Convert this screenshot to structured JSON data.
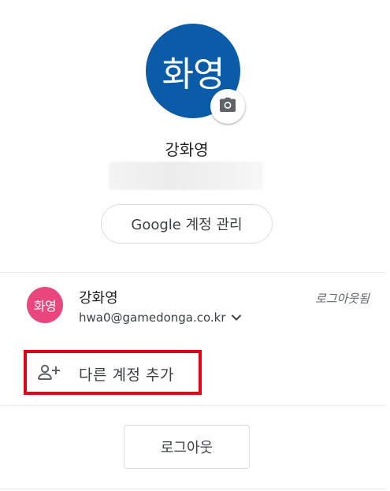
{
  "profile": {
    "avatar_initials": "화영",
    "avatar_color": "#0b5ca8",
    "camera_icon": "camera-icon",
    "name": "강화영",
    "manage_button_label": "Google 계정 관리"
  },
  "accounts": [
    {
      "avatar_initials": "화영",
      "avatar_color": "#e8467c",
      "name": "강화영",
      "email": "hwa0@gamedonga.co.kr",
      "status": "로그아웃됨",
      "expand_icon": "chevron-down-icon"
    }
  ],
  "add_account": {
    "label": "다른 계정 추가",
    "icon": "person-add-icon",
    "highlight_color": "#e60012"
  },
  "signout_button_label": "로그아웃"
}
